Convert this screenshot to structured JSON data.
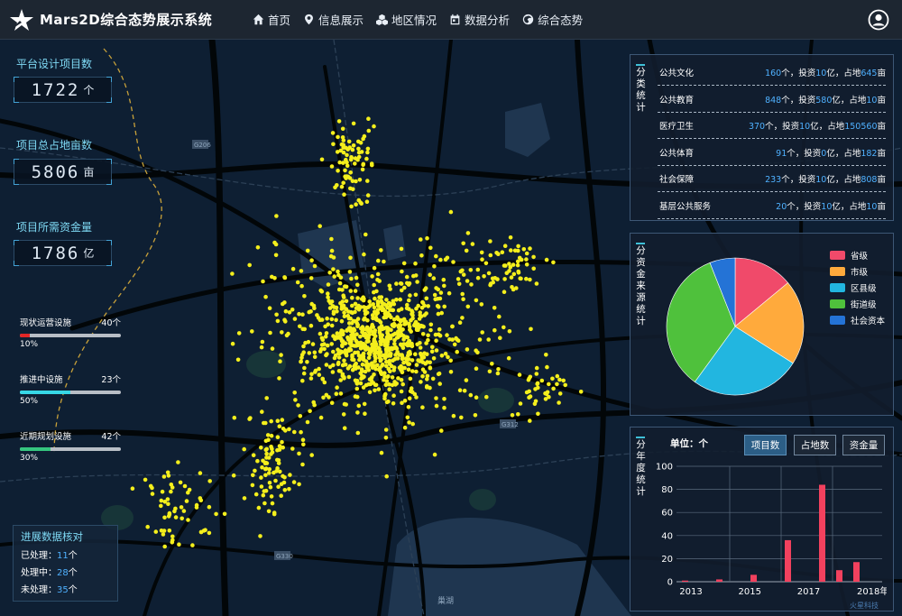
{
  "header": {
    "title": "Mars2D综合态势展示系统",
    "nav": [
      {
        "label": "首页",
        "icon": "home-icon"
      },
      {
        "label": "信息展示",
        "icon": "location-pin-icon"
      },
      {
        "label": "地区情况",
        "icon": "cubes-icon"
      },
      {
        "label": "数据分析",
        "icon": "calendar-icon"
      },
      {
        "label": "综合态势",
        "icon": "earth-icon"
      }
    ],
    "user_icon": "user-circle-icon"
  },
  "left": {
    "stats": [
      {
        "label": "平台设计项目数",
        "value": "1722",
        "unit": "个"
      },
      {
        "label": "项目总占地亩数",
        "value": "5806",
        "unit": "亩"
      },
      {
        "label": "项目所需资金量",
        "value": "1786",
        "unit": "亿"
      }
    ],
    "progress": [
      {
        "title": "现状运营设施",
        "count": "40个",
        "percent": 10,
        "pct_label": "10%",
        "color": "#e02626"
      },
      {
        "title": "推进中设施",
        "count": "23个",
        "percent": 50,
        "pct_label": "50%",
        "color": "#37d7e6"
      },
      {
        "title": "近期规划设施",
        "count": "42个",
        "percent": 30,
        "pct_label": "30%",
        "color": "#35c57f"
      }
    ],
    "verify": {
      "title": "进展数据核对",
      "rows": [
        {
          "label": "已处理：",
          "value": "11",
          "unit": "个"
        },
        {
          "label": "处理中：",
          "value": "28",
          "unit": "个"
        },
        {
          "label": "未处理：",
          "value": "35",
          "unit": "个"
        }
      ]
    }
  },
  "category": {
    "label": "分类统计",
    "rows": [
      {
        "name": "公共文化",
        "count": "160",
        "invest": "10",
        "area": "645"
      },
      {
        "name": "公共教育",
        "count": "848",
        "invest": "580",
        "area": "10"
      },
      {
        "name": "医疗卫生",
        "count": "370",
        "invest": "10",
        "area": "150560"
      },
      {
        "name": "公共体育",
        "count": "91",
        "invest": "0",
        "area": "182"
      },
      {
        "name": "社会保障",
        "count": "233",
        "invest": "10",
        "area": "808"
      },
      {
        "name": "基层公共服务",
        "count": "20",
        "invest": "10",
        "area": "10"
      }
    ],
    "text": {
      "unit_count": "个，投资",
      "unit_invest": "亿，占地",
      "unit_area": "亩"
    }
  },
  "funding": {
    "label": "分资金来源统计",
    "chart_data": {
      "type": "pie",
      "slices": [
        {
          "name": "省级",
          "value": 14,
          "color": "#f04a6a"
        },
        {
          "name": "市级",
          "value": 20,
          "color": "#ffaa3c"
        },
        {
          "name": "区县级",
          "value": 26,
          "color": "#22b6e0"
        },
        {
          "name": "街道级",
          "value": 34,
          "color": "#4fc13c"
        },
        {
          "name": "社会资本",
          "value": 6,
          "color": "#2473d6"
        }
      ]
    }
  },
  "yearly": {
    "label": "分年度统计",
    "unit_label": "单位：个",
    "buttons": [
      {
        "label": "项目数",
        "active": true
      },
      {
        "label": "占地数",
        "active": false
      },
      {
        "label": "资金量",
        "active": false
      }
    ],
    "chart_data": {
      "type": "bar",
      "x_labels": [
        "2013",
        "2015",
        "2017",
        "2018年"
      ],
      "x": [
        "2013.0",
        "2013.5",
        "2014.0",
        "2014.5",
        "2015.0",
        "2015.5",
        "2016.0",
        "2016.5",
        "2017.0",
        "2017.5",
        "2018.0",
        "2018.5"
      ],
      "values": [
        1,
        0,
        2,
        0,
        6,
        0,
        36,
        0,
        84,
        10,
        17,
        0
      ],
      "ylim": [
        0,
        100
      ],
      "yticks": [
        0,
        20,
        40,
        60,
        80,
        100
      ],
      "color": "#f2415e",
      "grid": true
    }
  },
  "watermark": "火星科技",
  "map": {
    "labels": [
      "G206",
      "G312",
      "G330",
      "巢湖"
    ]
  }
}
